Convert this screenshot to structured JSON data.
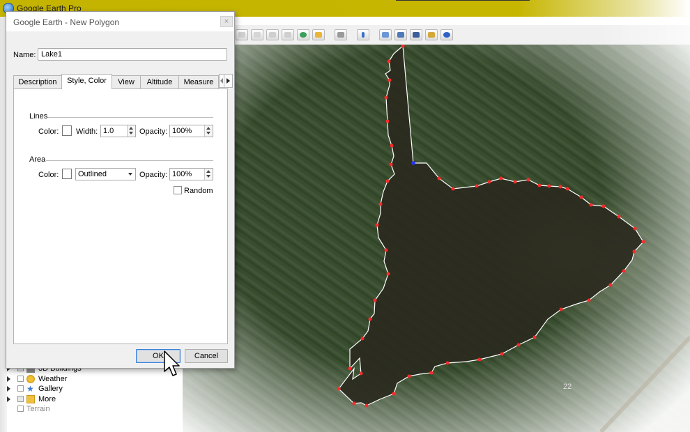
{
  "app": {
    "title": "Google Earth Pro"
  },
  "layers": [
    {
      "label": "3D Buildings"
    },
    {
      "label": "Weather"
    },
    {
      "label": "Gallery"
    },
    {
      "label": "More"
    },
    {
      "label": "Terrain"
    }
  ],
  "map": {
    "tile_label": "22"
  },
  "dialog": {
    "title": "Google Earth - New Polygon",
    "close_symbol": "×",
    "name_label": "Name:",
    "name_value": "Lake1",
    "tabs": [
      {
        "label": "Description"
      },
      {
        "label": "Style, Color"
      },
      {
        "label": "View"
      },
      {
        "label": "Altitude"
      },
      {
        "label": "Measure"
      }
    ],
    "active_tab": "Style, Color",
    "lines": {
      "heading": "Lines",
      "color_label": "Color:",
      "width_label": "Width:",
      "width_value": "1.0",
      "opacity_label": "Opacity:",
      "opacity_value": "100%"
    },
    "area": {
      "heading": "Area",
      "color_label": "Color:",
      "fill_mode": "Outlined",
      "opacity_label": "Opacity:",
      "opacity_value": "100%",
      "random_label": "Random"
    },
    "ok_label": "OK",
    "cancel_label": "Cancel"
  },
  "colors": {
    "title_bar": "#c4b400",
    "vertex": "#ff2a2a",
    "selected_vertex": "#2233ff",
    "polygon_line": "#ffffff",
    "lake_fill": "#2b2a1f"
  }
}
